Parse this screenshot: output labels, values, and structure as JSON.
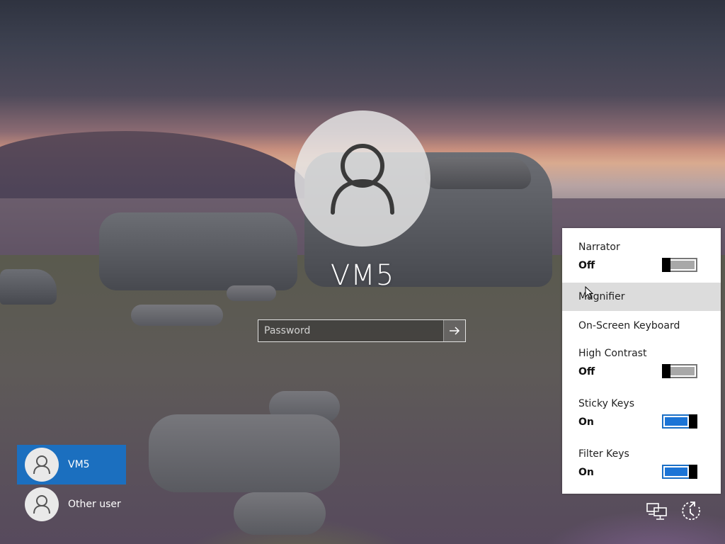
{
  "login": {
    "username": "VM5",
    "password_placeholder": "Password",
    "password_value": ""
  },
  "users": [
    {
      "name": "VM5",
      "selected": true
    },
    {
      "name": "Other user",
      "selected": false
    }
  ],
  "ease_of_access": {
    "items": [
      {
        "label": "Narrator",
        "state": "Off",
        "toggle": "off"
      },
      {
        "label": "Magnifier"
      },
      {
        "label": "On-Screen Keyboard"
      },
      {
        "label": "High Contrast",
        "state": "Off",
        "toggle": "off"
      },
      {
        "label": "Sticky Keys",
        "state": "On",
        "toggle": "on"
      },
      {
        "label": "Filter Keys",
        "state": "On",
        "toggle": "on"
      }
    ],
    "highlighted": "Magnifier"
  },
  "system_icons": {
    "network": "network-icon",
    "power": "power-icon",
    "submit": "arrow-right-icon",
    "user": "user-icon"
  },
  "colors": {
    "accent": "#1b6fbf",
    "toggle_on": "#1b74d6",
    "toggle_off": "#a8a8a8",
    "flyout_bg": "#ffffff",
    "highlight": "#dcdcdc"
  }
}
